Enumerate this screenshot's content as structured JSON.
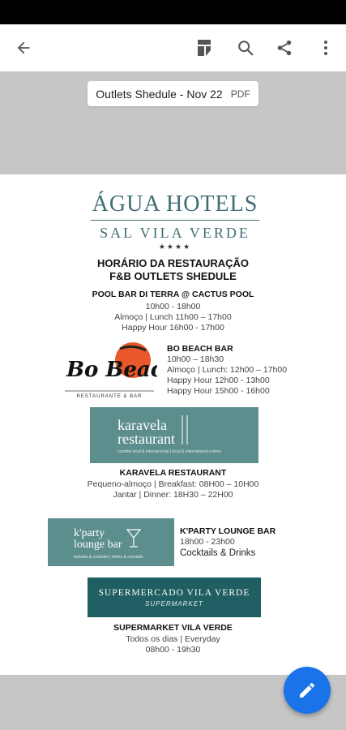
{
  "toolbar": {
    "back_icon": "arrow-left-icon",
    "icons": [
      "reading-mode-icon",
      "search-icon",
      "share-icon",
      "more-vert-icon"
    ]
  },
  "document": {
    "title": "Outlets Shedule - Nov 22",
    "type": "PDF"
  },
  "poster": {
    "brand": "ÁGUA HOTELS",
    "brand_sub": "SAL VILA VERDE",
    "stars": "★★★★",
    "heading1": "HORÁRIO DA RESTAURAÇÃO",
    "heading2": "F&B OUTLETS SHEDULE",
    "pool_bar": {
      "title": "POOL BAR DI TERRA @ CACTUS POOL",
      "lines": [
        "10h00 - 18h00",
        "Almoço | Lunch 11h00 – 17h00",
        "Happy Hour 16h00 - 17h00"
      ]
    },
    "beach_bar": {
      "logo_text": "Bo Beach Bar",
      "logo_sub": "RESTAURANTE & BAR",
      "title": "BO BEACH BAR",
      "lines": [
        "10h00 – 18h30",
        "Almoço | Lunch: 12h00 – 17h00",
        "Happy Hour 12h00 - 13h00",
        "Happy Hour 15h00 - 16h00"
      ]
    },
    "karavela": {
      "logo_line1": "karavela",
      "logo_line2": "restaurant",
      "logo_tagline": "cozinha local & internacional | local & international cuisine",
      "title": "KARAVELA RESTAURANT",
      "lines": [
        "Pequeno-almoço | Breakfast: 08H00 – 10H00",
        "Jantar | Dinner: 18H30 – 22H00"
      ]
    },
    "kparty": {
      "logo_line1": "k'party",
      "logo_line2": "lounge bar",
      "logo_tagline": "bebidas & cocktails | drinks & cocktails",
      "title": "K'PARTY LOUNGE BAR",
      "lines": [
        "18h00 - 23h00",
        "Cocktails & Drinks"
      ]
    },
    "supermarket": {
      "logo_line1": "SUPERMERCADO VILA VERDE",
      "logo_line2": "SUPERMARKET",
      "title": "SUPERMARKET VILA VERDE",
      "lines": [
        "Todos os dias | Everyday",
        "08h00 - 19h30"
      ]
    }
  },
  "fab": {
    "icon": "edit-pencil-icon"
  },
  "colors": {
    "teal": "#5d8e8e",
    "dark_teal": "#1f5e62",
    "brand": "#3f6e73",
    "fab": "#1a73e8",
    "sun": "#e8582a"
  }
}
